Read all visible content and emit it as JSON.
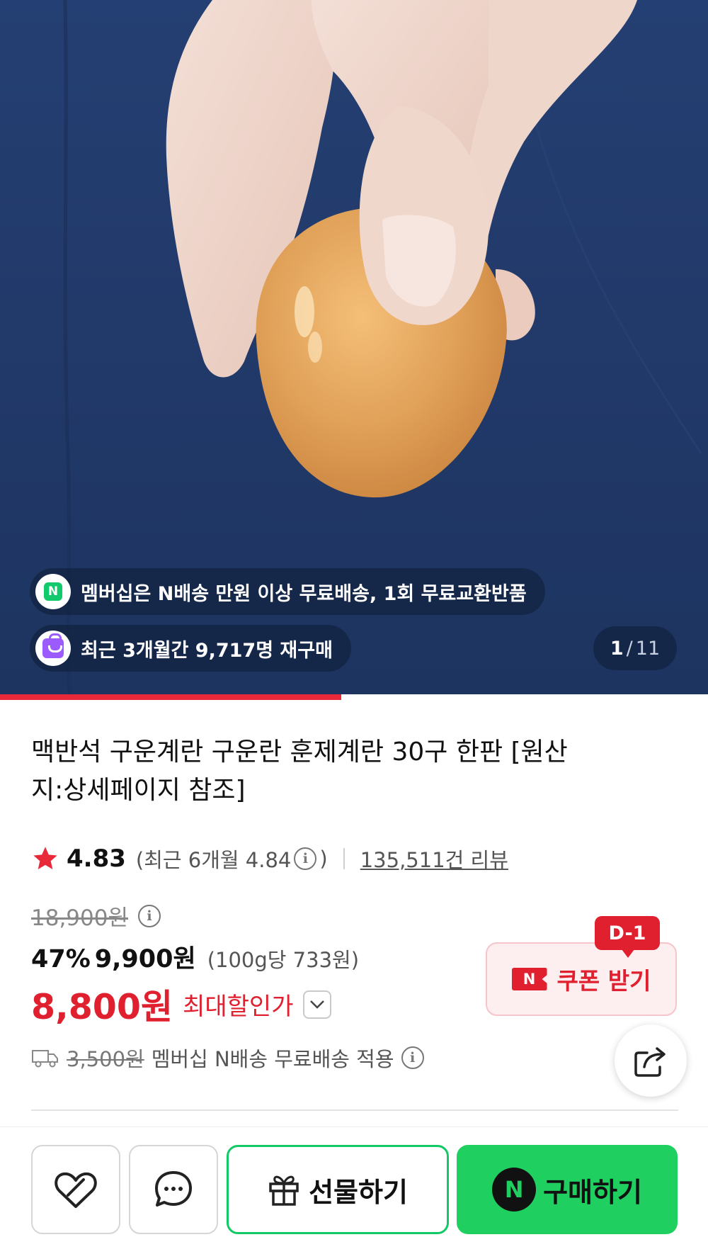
{
  "hero": {
    "image": "hand holding a roasted brown egg over blue fabric",
    "badges": {
      "membership_icon": "n-delivery-icon",
      "membership_text": "멤버십은 N배송 만원 이상 무료배송, 1회 무료교환반품",
      "rebuy_icon": "shopping-bag-icon",
      "rebuy_text": "최근 3개월간 9,717명 재구매"
    },
    "counter": {
      "current": "1",
      "separator": "/",
      "total": "11"
    },
    "progress_fraction": 0.4818
  },
  "product": {
    "title": "맥반석 구운계란 구운란 훈제계란 30구 한판 [원산지:상세페이지 참조]",
    "rating": {
      "score": "4.83",
      "recent_prefix": "(최근 6개월 4.84",
      "recent_suffix": ")",
      "reviews": "135,511건 리뷰"
    },
    "price": {
      "original": "18,900원",
      "discount": "47%",
      "sale": "9,900원",
      "unit": "(100g당 733원)",
      "best": "8,800원",
      "best_label": "최대할인가"
    },
    "coupon": {
      "dday": "D-1",
      "badge": "N",
      "label": "쿠폰 받기"
    },
    "shipping": {
      "original_fee": "3,500원",
      "text": "멤버십 N배송 무료배송 적용"
    }
  },
  "actions": {
    "gift_label": "선물하기",
    "buy_badge": "N",
    "buy_label": "구매하기"
  },
  "colors": {
    "accent_red": "#e1202f",
    "buy_green": "#1fd061",
    "gift_border": "#12c966",
    "hero_background": "#223a6a"
  }
}
